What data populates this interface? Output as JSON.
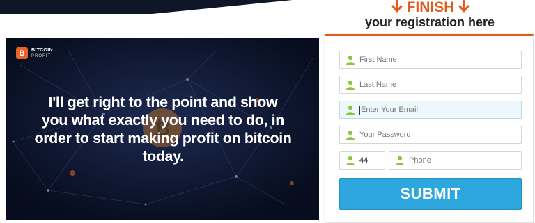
{
  "header": {
    "finish_label": "FINISH",
    "registration_label": "your registration here"
  },
  "video": {
    "logo_name": "BITCOIN",
    "logo_sub": "PROFIT",
    "headline": "I'll get right to the point and show you what exactly you need to do, in order to start making profit on bitcoin today."
  },
  "form": {
    "first_name_placeholder": "First Name",
    "last_name_placeholder": "Last Name",
    "email_placeholder": "Enter Your Email",
    "password_placeholder": "Your Password",
    "country_code_value": "44",
    "phone_placeholder": "Phone",
    "submit_label": "SUBMIT"
  },
  "colors": {
    "accent_orange": "#e45a1b",
    "submit_blue": "#2ea6de",
    "icon_green": "#8cc63f",
    "video_bg": "#0a1226"
  }
}
